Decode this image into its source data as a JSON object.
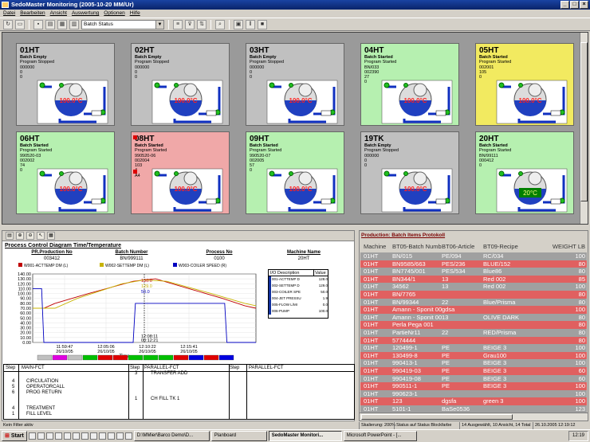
{
  "window": {
    "title": "SedoMaster Monitoring (2005-10-20 MM/Ur)"
  },
  "menu": [
    "Datei",
    "Bearbeiten",
    "Ansicht",
    "Auswertung",
    "Optionen",
    "Hilfe"
  ],
  "toolbar": {
    "view_select": "Batch Status"
  },
  "tanks": [
    {
      "id": "01HT",
      "status": "Batch Empty",
      "program": "Program Stopped",
      "lines": [
        "000000",
        "0",
        "0"
      ],
      "color": "#c0c0c0",
      "temp": "100.0°C",
      "temp_alarm": true,
      "mark": false
    },
    {
      "id": "02HT",
      "status": "Batch Empty",
      "program": "Program Stopped",
      "lines": [
        "000000",
        "0",
        "0"
      ],
      "color": "#c0c0c0",
      "temp": "100.0°C",
      "temp_alarm": true,
      "mark": false
    },
    {
      "id": "03HT",
      "status": "Batch Empty",
      "program": "Program Stopped",
      "lines": [
        "000000",
        "0",
        "0"
      ],
      "color": "#c0c0c0",
      "temp": "100.0°C",
      "temp_alarm": true,
      "mark": false
    },
    {
      "id": "04HT",
      "status": "Batch Started",
      "program": "Program Started",
      "lines": [
        "BN/033",
        "002390",
        "27",
        "0"
      ],
      "color": "#b6f0b0",
      "temp": "100.0°C",
      "temp_alarm": true,
      "mark": false
    },
    {
      "id": "05HT",
      "status": "Batch Started",
      "program": "Program Started",
      "lines": [
        "002001",
        "105",
        "0"
      ],
      "color": "#f2ea60",
      "temp": "100.0°C",
      "temp_alarm": true,
      "mark": false
    },
    {
      "id": "06HT",
      "status": "Batch Started",
      "program": "Program Started",
      "lines": [
        "990520-03",
        "002002",
        "74",
        "0"
      ],
      "color": "#b6f0b0",
      "temp": "100.0°C",
      "temp_alarm": true,
      "mark": false
    },
    {
      "id": "08HT",
      "status": "Batch Started",
      "program": "Program Started",
      "lines": [
        "990520-06",
        "002004",
        "103",
        "4",
        "A4"
      ],
      "color": "#f0a8a8",
      "temp": "100.0°C",
      "temp_alarm": true,
      "mark": true
    },
    {
      "id": "09HT",
      "status": "Batch Started",
      "program": "Program Started",
      "lines": [
        "990520-07",
        "002005",
        "57",
        "0"
      ],
      "color": "#b6f0b0",
      "temp": "100.0°C",
      "temp_alarm": true,
      "mark": false
    },
    {
      "id": "19TK",
      "status": "Batch Empty",
      "program": "Program Stopped",
      "lines": [
        "000000",
        "0",
        "0"
      ],
      "color": "#c0c0c0",
      "temp": "100.0°C",
      "temp_alarm": true,
      "mark": false
    },
    {
      "id": "20HT",
      "status": "Batch Started",
      "program": "Program Started",
      "lines": [
        "BN/99111",
        "000412",
        "0"
      ],
      "color": "#b6f0b0",
      "temp": "20°C",
      "temp_alarm": false,
      "mark": false
    }
  ],
  "process": {
    "title": "Process Control Diagram Time/Temperature",
    "pr_label": "PR.Production No",
    "pr_value": "003412",
    "batch_label": "Batch Number",
    "batch_value": "BN/999111",
    "proc_label": "Process No",
    "proc_value": "0100",
    "machine_label": "Machine Name",
    "machine_value": "20HT",
    "io_header": [
      "I/O Description",
      "Value"
    ],
    "io_rows": [
      {
        "name": "001-ACTTEMP D",
        "value": "128.0"
      },
      {
        "name": "002-SETTEMP D",
        "value": "129.0"
      },
      {
        "name": "003-COILER SPE",
        "value": "50.0"
      },
      {
        "name": "004-JET PRESSU",
        "value": "1.9"
      },
      {
        "name": "005-FLOW L/MI",
        "value": "0.0"
      },
      {
        "name": "006-PUMP",
        "value": "100.0"
      }
    ],
    "cursor_time": "12:08:11",
    "cursor_time2": "00:12:21",
    "steps_headers": [
      "Step",
      "MAIN-FCT",
      "Step",
      "PARALLEL-FCT",
      "Step",
      "PARALLEL-FCT"
    ],
    "steps_main": [
      {
        "step": "4",
        "fct": "CIRCULATION"
      },
      {
        "step": "5",
        "fct": "OPERATORCALL"
      },
      {
        "step": "6",
        "fct": "PROG RETURN"
      },
      {
        "step": "4",
        "fct": "TREATMENT"
      },
      {
        "step": "1",
        "fct": "FILL LEVEL"
      }
    ],
    "steps_par": [
      {
        "step": "3",
        "fct": "TRANSFER ADD"
      },
      {
        "step": "1",
        "fct": "CH FILL TK 1"
      }
    ]
  },
  "chart_data": {
    "type": "line",
    "legend": [
      "W001-ACTTEMP DM (L)",
      "W002-SETTEMP DM (L)",
      "W003-COILER SPEED (R)"
    ],
    "colors": [
      "#c00000",
      "#c8b400",
      "#0000c0"
    ],
    "yticks": [
      "140.00",
      "130.00",
      "120.00",
      "110.00",
      "100.00",
      "90.00",
      "80.00",
      "70.00",
      "60.00",
      "50.00",
      "40.00",
      "30.00",
      "20.00",
      "10.00",
      "0.00"
    ],
    "ylim": [
      0,
      140
    ],
    "xticks": [
      {
        "time": "11:59:47",
        "date": "26/10/05"
      },
      {
        "time": "12:05:06",
        "date": "26/10/05"
      },
      {
        "time": "12:10:22",
        "date": "26/10/05"
      },
      {
        "time": "12:15:41",
        "date": "26/10/05"
      }
    ],
    "xlabel": "Time",
    "cursor_labels": [
      "130.0",
      "129.0",
      "50.0"
    ],
    "series": [
      {
        "name": "W001-ACTTEMP DM (L)",
        "values": [
          [
            0,
            70
          ],
          [
            0.05,
            70
          ],
          [
            0.1,
            80
          ],
          [
            0.25,
            100
          ],
          [
            0.45,
            125
          ],
          [
            0.55,
            130
          ],
          [
            0.7,
            110
          ],
          [
            0.85,
            90
          ],
          [
            0.95,
            75
          ],
          [
            1,
            70
          ]
        ]
      },
      {
        "name": "W002-SETTEMP DM (L)",
        "values": [
          [
            0,
            70
          ],
          [
            0.1,
            70
          ],
          [
            0.2,
            90
          ],
          [
            0.4,
            120
          ],
          [
            0.5,
            128
          ],
          [
            0.6,
            125
          ],
          [
            0.8,
            100
          ],
          [
            0.95,
            80
          ],
          [
            1,
            75
          ]
        ]
      },
      {
        "name": "W003-COILER SPEED (R)",
        "values": [
          [
            0,
            110
          ],
          [
            0.04,
            110
          ],
          [
            0.05,
            0
          ],
          [
            0.45,
            0
          ],
          [
            0.46,
            80
          ],
          [
            0.86,
            80
          ],
          [
            0.87,
            0
          ],
          [
            1,
            0
          ]
        ]
      }
    ],
    "step_bar": [
      "#c0c0c0",
      "#e000e0",
      "#c0c0c0",
      "#00c000",
      "#e00000",
      "#e00000",
      "#00c000",
      "#00c000",
      "#00c000",
      "#e00000",
      "#0000e0",
      "#e00000",
      "#0000e0"
    ]
  },
  "protocol": {
    "title": "Production: Batch Items Protokoll",
    "headers": [
      "Machine",
      "BT05-Batch Number",
      "BT06-Article",
      "BT09-Recipe",
      "WEIGHT LB"
    ],
    "rows": [
      {
        "c": [
          "01HT",
          "BN/015",
          "PE/094",
          "RC/034",
          "100"
        ],
        "style": "grey"
      },
      {
        "c": [
          "01HT",
          "BN9585/663",
          "PES/236",
          "BLUE/152",
          "80"
        ],
        "style": "red"
      },
      {
        "c": [
          "01HT",
          "BN7745/001",
          "PES/534",
          "Blue86",
          "80"
        ],
        "style": "grey"
      },
      {
        "c": [
          "01HT",
          "BN344/1",
          "13",
          "Red 002",
          "85"
        ],
        "style": "red"
      },
      {
        "c": [
          "01HT",
          "34562",
          "13",
          "Red 002",
          "100"
        ],
        "style": "grey"
      },
      {
        "c": [
          "01HT",
          "BN/7765",
          "",
          "",
          "80"
        ],
        "style": "red"
      },
      {
        "c": [
          "01HT",
          "BN/99344",
          "22",
          "Blue/Prisma",
          "80"
        ],
        "style": "grey"
      },
      {
        "c": [
          "01HT",
          "Amann - Sponit 001",
          "gdsa",
          "",
          "100"
        ],
        "style": "red"
      },
      {
        "c": [
          "01HT",
          "Amann - Sponit 003",
          "13",
          "OLIVE DARK",
          "80"
        ],
        "style": "grey"
      },
      {
        "c": [
          "01HT",
          "Perla Pega 001",
          "",
          "",
          "80"
        ],
        "style": "red"
      },
      {
        "c": [
          "01HT",
          "PartieNr11",
          "22",
          "RED/Prisma",
          "80"
        ],
        "style": "grey"
      },
      {
        "c": [
          "01HT",
          "5774444",
          "",
          "",
          "80"
        ],
        "style": "red"
      },
      {
        "c": [
          "01HT",
          "120499-1",
          "PE",
          "BEIGE 3",
          "100"
        ],
        "style": "grey"
      },
      {
        "c": [
          "01HT",
          "130499-8",
          "PE",
          "Grau100",
          "100"
        ],
        "style": "red"
      },
      {
        "c": [
          "01HT",
          "990413-1",
          "PE",
          "BEIGE 3",
          "100"
        ],
        "style": "grey"
      },
      {
        "c": [
          "01HT",
          "990419-03",
          "PE",
          "BEIGE 3",
          "60"
        ],
        "style": "red"
      },
      {
        "c": [
          "01HT",
          "990419-08",
          "PE",
          "BEIGE 3",
          "60"
        ],
        "style": "grey"
      },
      {
        "c": [
          "01HT",
          "990511-1",
          "PE",
          "BEIGE 3",
          "100"
        ],
        "style": "red"
      },
      {
        "c": [
          "01HT",
          "990623-1",
          "",
          "",
          "100"
        ],
        "style": "grey"
      },
      {
        "c": [
          "01HT",
          "123",
          "dgsfa",
          "green 3",
          "100"
        ],
        "style": "red"
      },
      {
        "c": [
          "01HT",
          "5101-1",
          "BaSe0536",
          "",
          "123"
        ],
        "style": "grey"
      }
    ]
  },
  "statusbar": {
    "filter": "Kein Filter aktiv",
    "scale": "Skalierung: 200%",
    "mode": "Status auf Status Blockfarbe",
    "count": "14 Ausgewählt, 10 Ansicht, 14 Total",
    "datetime": "26.10.2005 12:19:12"
  },
  "taskbar": {
    "start": "Start",
    "items": [
      "D:\\MMier\\Barco Demo\\D...",
      "Planboard",
      "SedoMaster Monitori...",
      "Microsoft PowerPoint - [..."
    ],
    "active": 2,
    "clock": "12:19"
  }
}
